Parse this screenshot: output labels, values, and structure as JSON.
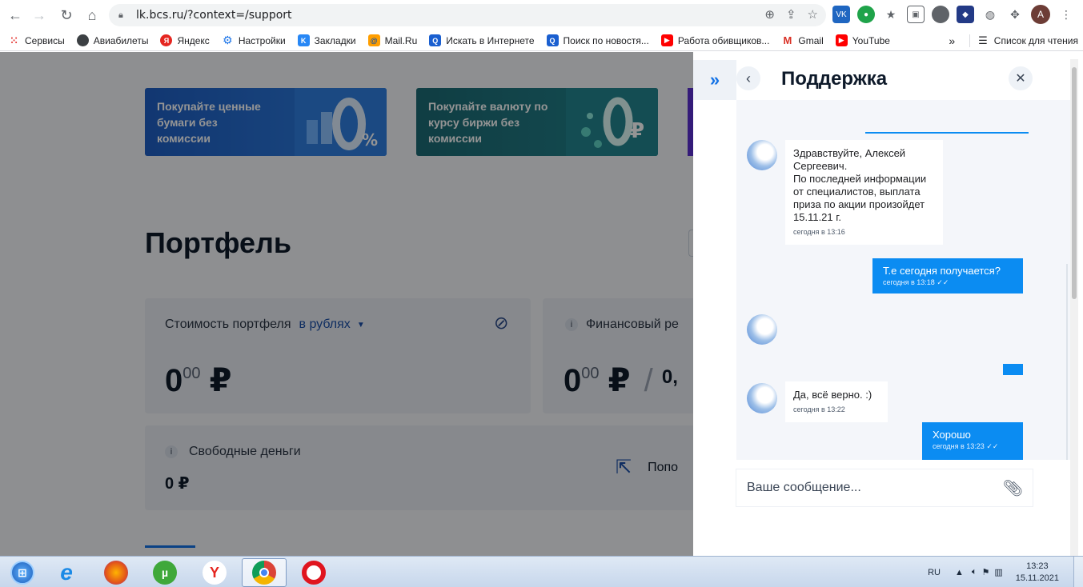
{
  "browser": {
    "url": "lk.bcs.ru/?context=/support",
    "bookmarks": [
      "Сервисы",
      "Авиабилеты",
      "Яндекс",
      "Настройки",
      "Закладки",
      "Mail.Ru",
      "Искать в Интернете",
      "Поиск по новостя...",
      "Работа обивщиков...",
      "Gmail",
      "YouTube"
    ],
    "reading_list": "Список для чтения",
    "more": "»",
    "avatar_letter": "А"
  },
  "page": {
    "banner1": "Покупайте ценные бумаги без комиссии",
    "banner2": "Покупайте валюту по курсу биржи без комиссии",
    "title": "Портфель",
    "portfolio_value_label": "Стоимость портфеля",
    "currency_selector": "в рублях",
    "portfolio_value_int": "0",
    "portfolio_value_dec": "00",
    "currency_sign": "₽",
    "financial_result_label": "Финансовый ре",
    "financial_result_int": "0",
    "financial_result_dec": "00",
    "financial_result_tail": "0,",
    "free_money_label": "Свободные деньги",
    "free_money_value": "0 ₽",
    "topup_label": "Попо"
  },
  "support": {
    "title": "Поддержка",
    "messages": [
      {
        "text": "Здравствуйте, Алексей Сергеевич.\nПо последней информации от специалистов, выплата приза по акции произойдет 15.11.21 г.",
        "time": "сегодня в 13:16"
      },
      {
        "text": "Т.е сегодня получается?",
        "time": "сегодня в 13:18"
      },
      {
        "text": "Да, всё верно. :)",
        "time": "сегодня в 13:22"
      },
      {
        "text": "Хорошо",
        "time": "сегодня в 13:23"
      }
    ],
    "input_placeholder": "Ваше сообщение..."
  },
  "taskbar": {
    "lang": "RU",
    "time": "13:23",
    "date": "15.11.2021"
  },
  "colors": {
    "accent": "#0b8cf2",
    "brand_blue": "#1473e6",
    "banner1": "#1f5fc4",
    "banner2": "#1c6a74"
  }
}
